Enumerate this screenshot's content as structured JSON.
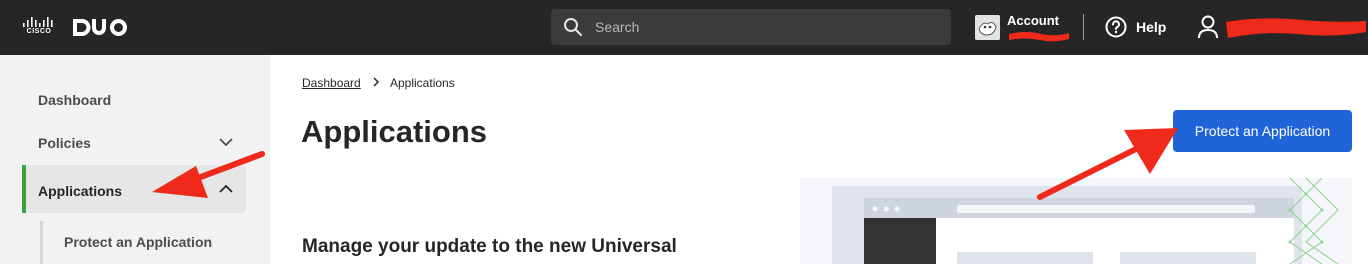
{
  "topbar": {
    "brand_cisco": "CISCO",
    "search_placeholder": "Search",
    "account_label": "Account",
    "help_label": "Help"
  },
  "sidebar": {
    "items": [
      {
        "label": "Dashboard"
      },
      {
        "label": "Policies"
      },
      {
        "label": "Applications"
      }
    ],
    "subitems": [
      {
        "label": "Protect an Application"
      }
    ]
  },
  "breadcrumb": {
    "home": "Dashboard",
    "current": "Applications"
  },
  "main": {
    "title": "Applications",
    "protect_button_label": "Protect an Application",
    "section_heading": "Manage your update to the new Universal"
  },
  "colors": {
    "topbar_bg": "#262626",
    "primary_button": "#1f64d9",
    "active_indicator": "#3aa43a",
    "annotation_arrow": "#ef2a1b"
  }
}
